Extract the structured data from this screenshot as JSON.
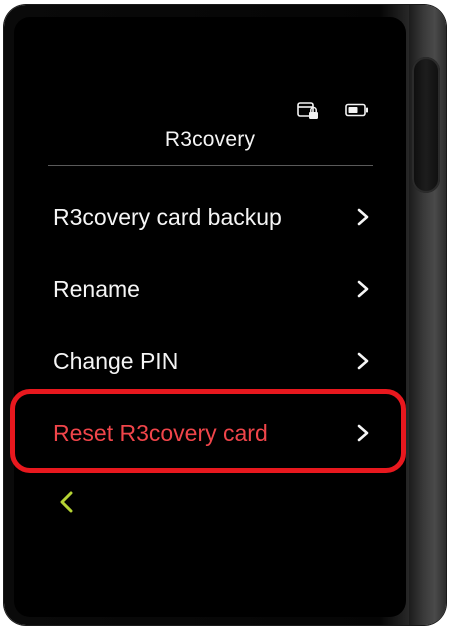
{
  "header": {
    "title": "R3covery",
    "status_icons": [
      "card-lock-icon",
      "battery-icon"
    ]
  },
  "menu": {
    "items": [
      {
        "label": "R3covery card backup",
        "icon": "chevron-right-icon"
      },
      {
        "label": "Rename",
        "icon": "chevron-right-icon"
      },
      {
        "label": "Change PIN",
        "icon": "chevron-right-icon"
      },
      {
        "label": "Reset R3covery card",
        "icon": "chevron-right-icon",
        "destructive": true
      }
    ]
  },
  "navigation": {
    "back_icon": "chevron-left-icon"
  },
  "colors": {
    "screen_background": "#000000",
    "text": "#f5f5f5",
    "destructive": "#f0454a",
    "highlight_outline": "#e8181e",
    "back_accent": "#b5d334",
    "divider": "#5a5a5a"
  }
}
